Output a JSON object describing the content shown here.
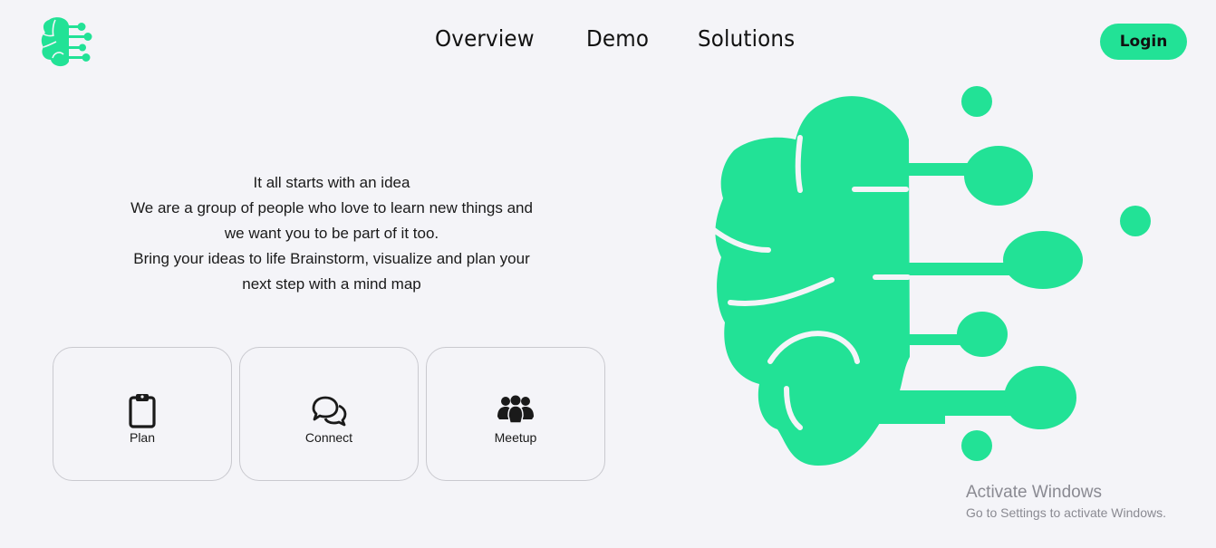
{
  "nav": {
    "items": [
      {
        "label": "Overview"
      },
      {
        "label": "Demo"
      },
      {
        "label": "Solutions"
      }
    ],
    "login_label": "Login"
  },
  "hero": {
    "lines": [
      "It all starts with an idea",
      "We are a group of people who love to learn new things and",
      "we want you to be part of it too.",
      "Bring your ideas to life Brainstorm, visualize and plan your",
      "next step with a mind map"
    ]
  },
  "cards": [
    {
      "label": "Plan",
      "icon": "clipboard-icon"
    },
    {
      "label": "Connect",
      "icon": "chat-bubbles-icon"
    },
    {
      "label": "Meetup",
      "icon": "group-icon"
    }
  ],
  "illustration": {
    "icon": "brain-circuit-icon"
  },
  "watermark": {
    "title": "Activate Windows",
    "subtitle": "Go to Settings to activate Windows."
  },
  "colors": {
    "accent": "#22e296",
    "background": "#f4f4f8",
    "text": "#1a1a1a",
    "card_border": "#c9c9cf",
    "watermark": "#8a8a92"
  }
}
